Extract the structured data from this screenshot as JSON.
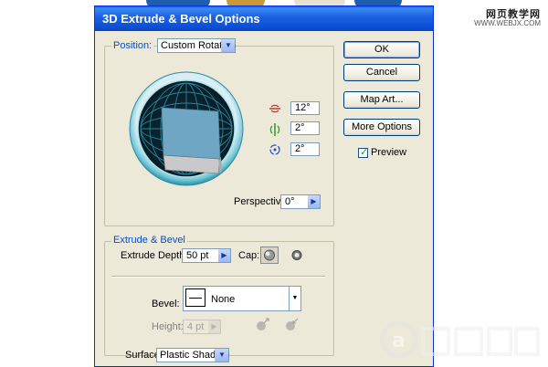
{
  "dialog": {
    "title": "3D Extrude & Bevel Options"
  },
  "watermark": {
    "title": "网页教学网",
    "url": "WWW.WEBJX.COM"
  },
  "position": {
    "label": "Position:",
    "selected": "Custom Rotation",
    "x_angle": "12°",
    "y_angle": "2°",
    "z_angle": "2°",
    "perspective_label": "Perspective:",
    "perspective_value": "0°"
  },
  "buttons": {
    "ok": "OK",
    "cancel": "Cancel",
    "map_art": "Map Art...",
    "more_options": "More Options"
  },
  "preview": {
    "label": "Preview",
    "checked": true
  },
  "extrude_bevel": {
    "section_label": "Extrude & Bevel",
    "depth_label": "Extrude Depth:",
    "depth_value": "50 pt",
    "cap_label": "Cap:",
    "bevel_label": "Bevel:",
    "bevel_value": "None",
    "height_label": "Height:",
    "height_value": "4 pt"
  },
  "surface": {
    "label": "Surface:",
    "value": "Plastic Shading"
  },
  "colors": {
    "title_bar": "#0a53da",
    "dialog_bg": "#ece9d8",
    "sphere_teal": "#4fb2c4",
    "cube_face": "#6fa6c3",
    "label_blue": "#0a4dc8"
  }
}
